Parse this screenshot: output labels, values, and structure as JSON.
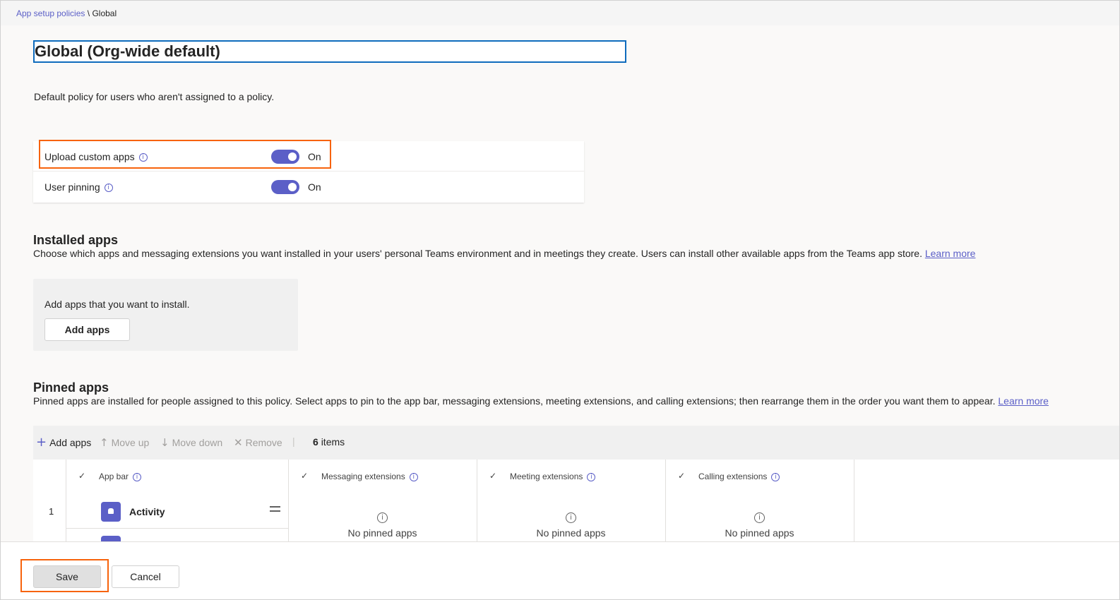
{
  "breadcrumb": {
    "parent": "App setup policies",
    "separator": "\\",
    "current": "Global"
  },
  "policy": {
    "name": "Global (Org-wide default)",
    "description": "Default policy for users who aren't assigned to a policy."
  },
  "settings": [
    {
      "label": "Upload custom apps",
      "state": "On",
      "enabled": true
    },
    {
      "label": "User pinning",
      "state": "On",
      "enabled": true
    }
  ],
  "installed_apps": {
    "title": "Installed apps",
    "description": "Choose which apps and messaging extensions you want installed in your users' personal Teams environment and in meetings they create. Users can install other available apps from the Teams app store.",
    "learn_more": "Learn more",
    "box_text": "Add apps that you want to install.",
    "add_button": "Add apps"
  },
  "pinned_apps": {
    "title": "Pinned apps",
    "description": "Pinned apps are installed for people assigned to this policy. Select apps to pin to the app bar, messaging extensions, meeting extensions, and calling extensions; then rearrange them in the order you want them to appear.",
    "learn_more": "Learn more",
    "toolbar": {
      "add": "Add apps",
      "move_up": "Move up",
      "move_down": "Move down",
      "remove": "Remove",
      "count": "6",
      "count_suffix": "items"
    },
    "columns": [
      "App bar",
      "Messaging extensions",
      "Meeting extensions",
      "Calling extensions"
    ],
    "rows": [
      {
        "index": "1",
        "name": "Activity",
        "icon": "bell-icon"
      }
    ],
    "empty_text": "No pinned apps"
  },
  "footer": {
    "save": "Save",
    "cancel": "Cancel"
  },
  "colors": {
    "accent": "#5b5fc7",
    "highlight": "#f7630c",
    "focus_border": "#0f6cbd"
  }
}
